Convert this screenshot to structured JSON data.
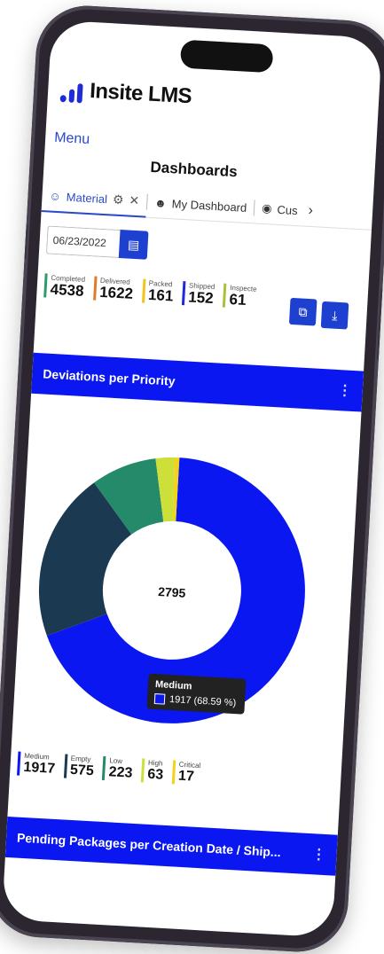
{
  "app": {
    "brand": "Insite LMS"
  },
  "nav": {
    "menu_label": "Menu"
  },
  "page": {
    "title": "Dashboards"
  },
  "tabs": [
    {
      "label": "Material"
    },
    {
      "label": "My Dashboard"
    },
    {
      "label": "Cus"
    }
  ],
  "date_filter": {
    "value": "06/23/2022"
  },
  "stats": [
    {
      "label": "Completed",
      "value": "4538",
      "color": "#2e9b6b"
    },
    {
      "label": "Delivered",
      "value": "1622",
      "color": "#e07b28"
    },
    {
      "label": "Packed",
      "value": "161",
      "color": "#f0c419"
    },
    {
      "label": "Shipped",
      "value": "152",
      "color": "#1e2bd8"
    },
    {
      "label": "Inspecte",
      "value": "61",
      "color": "#a9c23a"
    }
  ],
  "cards": [
    {
      "title": "Deviations per Priority"
    },
    {
      "title": "Pending Packages per Creation Date / Ship..."
    }
  ],
  "chart_data": {
    "type": "pie",
    "title": "Deviations per Priority",
    "total": "2795",
    "series": [
      {
        "name": "Medium",
        "value": 1917,
        "color": "#0a17f0"
      },
      {
        "name": "Empty",
        "value": 575,
        "color": "#1b3a52"
      },
      {
        "name": "Low",
        "value": 223,
        "color": "#248a6a"
      },
      {
        "name": "High",
        "value": 63,
        "color": "#cde03a"
      },
      {
        "name": "Critical",
        "value": 17,
        "color": "#f2d21b"
      }
    ],
    "tooltip": {
      "title": "Medium",
      "text": "1917 (68.59 %)"
    }
  },
  "legend": [
    {
      "label": "Medium",
      "value": "1917",
      "color": "#0a17f0"
    },
    {
      "label": "Empty",
      "value": "575",
      "color": "#1b3a52"
    },
    {
      "label": "Low",
      "value": "223",
      "color": "#248a6a"
    },
    {
      "label": "High",
      "value": "63",
      "color": "#cde03a"
    },
    {
      "label": "Critical",
      "value": "17",
      "color": "#f2d21b"
    }
  ]
}
